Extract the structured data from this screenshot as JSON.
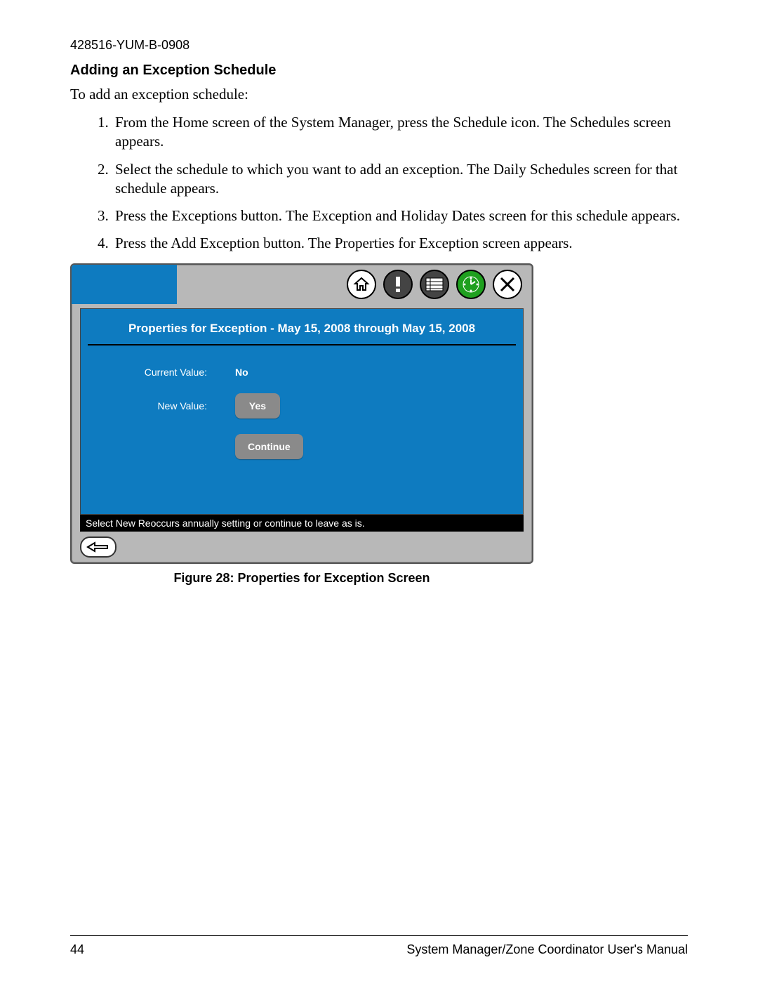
{
  "doc_id": "428516-YUM-B-0908",
  "section_heading": "Adding an Exception Schedule",
  "intro": "To add an exception schedule:",
  "steps": [
    "From the Home screen of the System Manager, press the Schedule icon. The Schedules screen appears.",
    "Select the schedule to which you want to add an exception. The Daily Schedules screen for that schedule appears.",
    "Press the Exceptions button. The Exception and Holiday Dates screen for this schedule appears.",
    "Press the Add Exception button. The Properties for Exception screen appears."
  ],
  "screen": {
    "title": "Properties for Exception - May 15, 2008 through May 15, 2008",
    "current_value_label": "Current Value:",
    "current_value": "No",
    "new_value_label": "New Value:",
    "yes_button": "Yes",
    "continue_button": "Continue",
    "status_text": "Select New Reoccurs annually setting or continue to leave as is.",
    "icons": {
      "home": "home-icon",
      "alert": "alert-icon",
      "list": "list-icon",
      "clock": "clock-icon",
      "tools": "tools-icon",
      "back": "back-arrow-icon"
    }
  },
  "figure_caption": "Figure 28: Properties for Exception Screen",
  "footer": {
    "page_num": "44",
    "manual_title": "System Manager/Zone Coordinator User's Manual"
  }
}
